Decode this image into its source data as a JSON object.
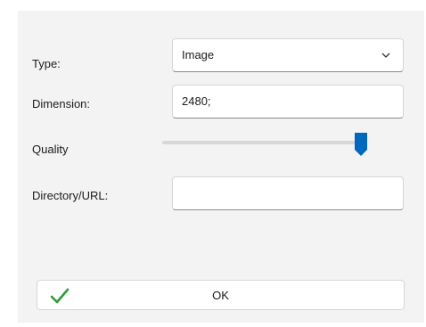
{
  "form": {
    "type": {
      "label": "Type:",
      "selected": "Image"
    },
    "dimension": {
      "label": "Dimension:",
      "value": "2480;"
    },
    "quality": {
      "label": "Quality",
      "level": 0.97
    },
    "directory": {
      "label": "Directory/URL:",
      "value": ""
    }
  },
  "ok_button": {
    "label": "OK",
    "icon": "checkmark-icon"
  },
  "colors": {
    "accent": "#0067c0",
    "check": "#2e9b3a",
    "panel": "#f3f3f3"
  }
}
